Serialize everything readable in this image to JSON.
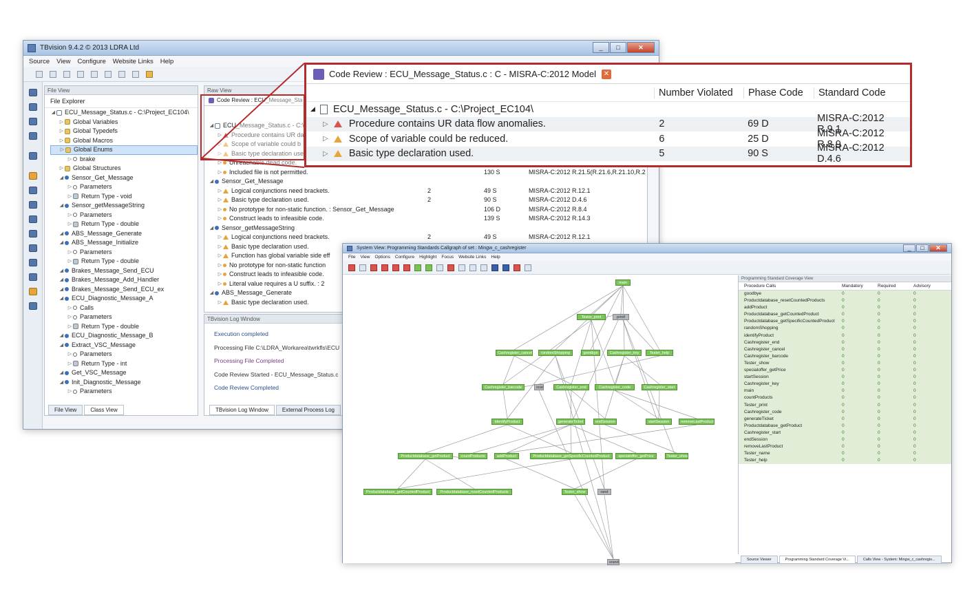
{
  "main_window": {
    "title": "TBvision 9.4.2 © 2013 LDRA Ltd",
    "menu": [
      "Source",
      "View",
      "Configure",
      "Website Links",
      "Help"
    ],
    "file_view": {
      "panel_title": "File View",
      "explorer_label": "File Explorer",
      "root": "ECU_Message_Status.c - C:\\Project_EC104\\",
      "items": [
        {
          "label": "Global Variables",
          "icon": "folder",
          "indent": 1
        },
        {
          "label": "Global Typedefs",
          "icon": "folder",
          "indent": 1
        },
        {
          "label": "Global Macros",
          "icon": "folder",
          "indent": 1
        },
        {
          "label": "Global Enums",
          "icon": "folder",
          "indent": 1,
          "selected": true
        },
        {
          "label": "brake",
          "icon": "param",
          "indent": 2
        },
        {
          "label": "Global Structures",
          "icon": "folder",
          "indent": 1
        },
        {
          "label": "Sensor_Get_Message",
          "icon": "func",
          "indent": 1
        },
        {
          "label": "Parameters",
          "icon": "param",
          "indent": 2
        },
        {
          "label": "Return Type - void",
          "icon": "ret",
          "indent": 2
        },
        {
          "label": "Sensor_getMessageString",
          "icon": "func",
          "indent": 1
        },
        {
          "label": "Parameters",
          "icon": "param",
          "indent": 2
        },
        {
          "label": "Return Type - double",
          "icon": "ret",
          "indent": 2
        },
        {
          "label": "ABS_Message_Generate",
          "icon": "func",
          "indent": 1
        },
        {
          "label": "ABS_Message_Initialize",
          "icon": "func",
          "indent": 1
        },
        {
          "label": "Parameters",
          "icon": "param",
          "indent": 2
        },
        {
          "label": "Return Type - double",
          "icon": "ret",
          "indent": 2
        },
        {
          "label": "Brakes_Message_Send_ECU",
          "icon": "func",
          "indent": 1
        },
        {
          "label": "Brakes_Message_Add_Handler",
          "icon": "func",
          "indent": 1
        },
        {
          "label": "Brakes_Message_Send_ECU_ex",
          "icon": "func",
          "indent": 1
        },
        {
          "label": "ECU_Diagnostic_Message_A",
          "icon": "func",
          "indent": 1
        },
        {
          "label": "Calls",
          "icon": "param",
          "indent": 2
        },
        {
          "label": "Parameters",
          "icon": "param",
          "indent": 2
        },
        {
          "label": "Return Type - double",
          "icon": "ret",
          "indent": 2
        },
        {
          "label": "ECU_Diagnostic_Message_B",
          "icon": "func",
          "indent": 1
        },
        {
          "label": "Extract_VSC_Message",
          "icon": "func",
          "indent": 1
        },
        {
          "label": "Parameters",
          "icon": "param",
          "indent": 2
        },
        {
          "label": "Return Type - int",
          "icon": "ret",
          "indent": 2
        },
        {
          "label": "Get_VSC_Message",
          "icon": "func",
          "indent": 1
        },
        {
          "label": "Init_Diagnostic_Message",
          "icon": "func",
          "indent": 1
        },
        {
          "label": "Parameters",
          "icon": "param",
          "indent": 2
        }
      ],
      "tabs": [
        "File View",
        "Class View"
      ]
    },
    "raw_view": {
      "panel_title": "Raw View",
      "tab": "Code Review : ECU_Message_Sta",
      "rows": [
        {
          "text": "ECU_Message_Status.c - C:\\Pr",
          "num": "",
          "code": "",
          "std": "",
          "icon": "file",
          "indent": 0
        },
        {
          "text": "Procedure contains UR da",
          "num": "",
          "code": "",
          "std": "",
          "icon": "warnr",
          "indent": 1
        },
        {
          "text": "Scope of variable could b",
          "num": "",
          "code": "",
          "std": "",
          "icon": "warn",
          "indent": 1
        },
        {
          "text": "Basic type declaration use",
          "num": "",
          "code": "",
          "std": "",
          "icon": "warn",
          "indent": 1
        },
        {
          "text": "Unreachable dead code.",
          "num": "",
          "code": "",
          "std": "",
          "icon": "dot",
          "indent": 1
        },
        {
          "text": "Included file is not permitted.",
          "num": "",
          "code": "130 S",
          "std": "MISRA-C:2012 R.21.5(R.21.6,R.21.10,R.21...",
          "icon": "dot",
          "indent": 1
        },
        {
          "text": "Sensor_Get_Message",
          "num": "",
          "code": "",
          "std": "",
          "icon": "func",
          "indent": 0
        },
        {
          "text": "Logical conjunctions need brackets.",
          "num": "2",
          "code": "49 S",
          "std": "MISRA-C:2012 R.12.1",
          "icon": "warn",
          "indent": 1
        },
        {
          "text": "Basic type declaration used.",
          "num": "2",
          "code": "90 S",
          "std": "MISRA-C:2012 D.4.6",
          "icon": "warn",
          "indent": 1
        },
        {
          "text": "No prototype for non-static function. : Sensor_Get_Message",
          "num": "",
          "code": "106 D",
          "std": "MISRA-C:2012 R.8.4",
          "icon": "dot",
          "indent": 1
        },
        {
          "text": "Construct leads to infeasible code.",
          "num": "",
          "code": "139 S",
          "std": "MISRA-C:2012 R.14.3",
          "icon": "dot",
          "indent": 1
        },
        {
          "text": "Sensor_getMessageString",
          "num": "",
          "code": "",
          "std": "",
          "icon": "func",
          "indent": 0
        },
        {
          "text": "Logical conjunctions need brackets.",
          "num": "2",
          "code": "49 S",
          "std": "MISRA-C:2012 R.12.1",
          "icon": "warn",
          "indent": 1
        },
        {
          "text": "Basic type declaration used.",
          "num": "",
          "code": "",
          "std": "",
          "icon": "warn",
          "indent": 1
        },
        {
          "text": "Function has global variable side eff",
          "num": "",
          "code": "",
          "std": "",
          "icon": "warn",
          "indent": 1
        },
        {
          "text": "No prototype for non-static function",
          "num": "",
          "code": "",
          "std": "",
          "icon": "dot",
          "indent": 1
        },
        {
          "text": "Construct leads to infeasible code.",
          "num": "",
          "code": "",
          "std": "",
          "icon": "dot",
          "indent": 1
        },
        {
          "text": "Literal value requires a U suffix. : 2",
          "num": "",
          "code": "",
          "std": "",
          "icon": "dot",
          "indent": 1
        },
        {
          "text": "ABS_Message_Generate",
          "num": "",
          "code": "",
          "std": "",
          "icon": "func",
          "indent": 0
        },
        {
          "text": "Basic type declaration used.",
          "num": "",
          "code": "",
          "std": "",
          "icon": "warn",
          "indent": 1
        }
      ]
    },
    "log": {
      "title": "TBvision Log Window",
      "lines": [
        "Execution completed",
        "Processing File C:\\LDRA_Workarea\\twrkfls\\ECU",
        "Processing File Completed",
        "Code Review Started - ECU_Message_Status.c",
        "Code Review Completed"
      ],
      "tabs": [
        "TBvision Log Window",
        "External Process Log"
      ]
    }
  },
  "zoom_panel": {
    "title": "Code Review : ECU_Message_Status.c : C - MISRA-C:2012  Model",
    "columns": [
      "Number Violated",
      "Phase Code",
      "Standard Code"
    ],
    "root": "ECU_Message_Status.c - C:\\Project_EC104\\",
    "rows": [
      {
        "text": "Procedure contains UR data flow anomalies.",
        "num": "2",
        "code": "69 D",
        "std": "MISRA-C:2012 R.9.1",
        "severity": "red"
      },
      {
        "text": "Scope of variable could be reduced.",
        "num": "6",
        "code": "25 D",
        "std": "MISRA-C:2012 R.8.9",
        "severity": "orange"
      },
      {
        "text": "Basic type declaration used.",
        "num": "5",
        "code": "90 S",
        "std": "MISRA-C:2012 D.4.6",
        "severity": "orange"
      }
    ]
  },
  "system_view": {
    "title": "System View: Programming Standards Callgraph of set : Mingw_c_cashregister",
    "menu": [
      "File",
      "View",
      "Options",
      "Configure",
      "Highlight",
      "Focus",
      "Website Links",
      "Help"
    ],
    "nodes": [
      {
        "label": "main",
        "grey": false
      },
      {
        "label": "Tester_print",
        "grey": false
      },
      {
        "label": "printf",
        "grey": true
      },
      {
        "label": "Cashregister_cancel",
        "grey": false
      },
      {
        "label": "randomShopping",
        "grey": false
      },
      {
        "label": "goodbye",
        "grey": false
      },
      {
        "label": "Cashregister_key",
        "grey": false
      },
      {
        "label": "Tester_help",
        "grey": false
      },
      {
        "label": "Cashregister_barcode",
        "grey": false
      },
      {
        "label": "scanf",
        "grey": true
      },
      {
        "label": "Cashregister_end",
        "grey": false
      },
      {
        "label": "Cashregister_code",
        "grey": false
      },
      {
        "label": "Cashregister_start",
        "grey": false
      },
      {
        "label": "identifyProduct",
        "grey": false
      },
      {
        "label": "generateTicket",
        "grey": false
      },
      {
        "label": "endSession",
        "grey": false
      },
      {
        "label": "startSession",
        "grey": false
      },
      {
        "label": "removeLastProduct",
        "grey": false
      },
      {
        "label": "Productdatabase_getProduct",
        "grey": false
      },
      {
        "label": "countProducts",
        "grey": false
      },
      {
        "label": "addProduct",
        "grey": false
      },
      {
        "label": "Productdatabase_getSpecificCountedProduct",
        "grey": false
      },
      {
        "label": "specialoffer_getPrice",
        "grey": false
      },
      {
        "label": "Tester_show",
        "grey": false
      },
      {
        "label": "Productdatabase_getCountedProduct",
        "grey": false
      },
      {
        "label": "Productdatabase_resetCountedProducts",
        "grey": false
      },
      {
        "label": "Tester_show",
        "grey": false
      },
      {
        "label": "rand",
        "grey": true
      },
      {
        "label": "srand",
        "grey": true
      }
    ],
    "coverage": {
      "title": "Programming Standard Coverage View",
      "headers": [
        "Procedure Calls",
        "Mandatory",
        "Required",
        "Advisory"
      ],
      "rows": [
        "goodbye",
        "Productdatabase_resetCountedProducts",
        "addProduct",
        "Productdatabase_getCountedProduct",
        "Productdatabase_getSpecificCountedProduct",
        "randomShopping",
        "identifyProduct",
        "Cashregister_end",
        "Cashregister_cancel",
        "Cashregister_barcode",
        "Tester_show",
        "specialoffer_getPrice",
        "startSession",
        "Cashregister_key",
        "main",
        "countProducts",
        "Tester_print",
        "Cashregister_code",
        "generateTicket",
        "Productdatabase_getProduct",
        "Cashregister_start",
        "endSession",
        "removeLastProduct",
        "Tester_name",
        "Tester_help"
      ],
      "value": "0",
      "tabs": [
        "Source Viewer",
        "Programming Standard Coverage Vi...",
        "Calls View - System: Mingw_c_cashregis..."
      ]
    }
  }
}
